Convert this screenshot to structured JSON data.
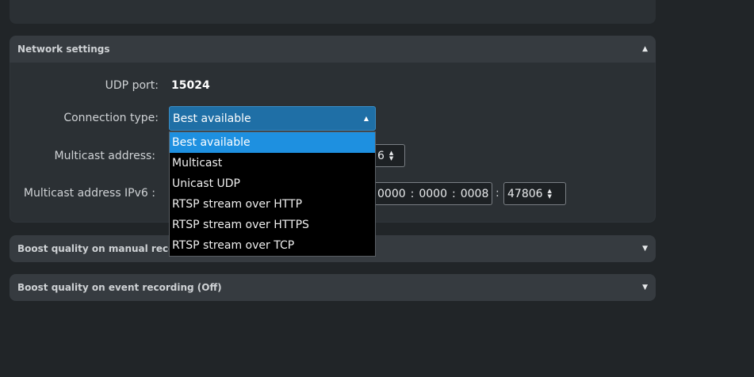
{
  "network": {
    "title": "Network settings",
    "udp_port_label": "UDP port:",
    "udp_port_value": "15024",
    "connection_type_label": "Connection type:",
    "connection_type_value": "Best available",
    "multicast_label": "Multicast address:",
    "multicast_port_partial": "6",
    "multicast_ipv6_label": "Multicast address IPv6 :",
    "ipv6_group_a": "0000",
    "ipv6_group_b": "0000",
    "ipv6_group_c": "0008",
    "ipv6_port": "47806"
  },
  "dropdown": {
    "options": [
      "Best available",
      "Multicast",
      "Unicast UDP",
      "RTSP stream over HTTP",
      "RTSP stream over HTTPS",
      "RTSP stream over TCP"
    ],
    "selected_index": 0
  },
  "boost_manual": {
    "title": "Boost quality on manual record"
  },
  "boost_event": {
    "title": "Boost quality on event recording (Off)"
  },
  "icons": {
    "caret_up": "caret-up-icon",
    "caret_down": "caret-down-icon"
  }
}
